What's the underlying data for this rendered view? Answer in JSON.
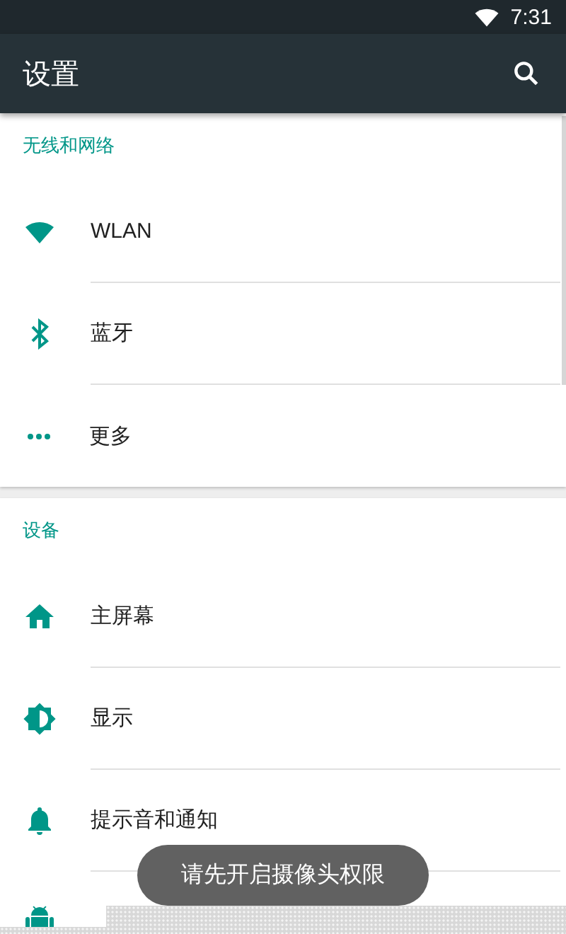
{
  "status_bar": {
    "time": "7:31"
  },
  "toolbar": {
    "title": "设置"
  },
  "sections": [
    {
      "title": "无线和网络",
      "items": [
        {
          "kind": "full",
          "label": "WLAN"
        },
        {
          "kind": "full",
          "label": "蓝牙"
        },
        {
          "kind": "full",
          "label": "更多"
        }
      ]
    },
    {
      "title": "设备",
      "items": [
        {
          "kind": "full",
          "label": "主屏幕"
        },
        {
          "kind": "full",
          "label": "显示"
        },
        {
          "kind": "full",
          "label": "提示音和通知"
        },
        {
          "kind": "cut-off"
        }
      ]
    }
  ],
  "toast": "请先开启摄像头权限"
}
